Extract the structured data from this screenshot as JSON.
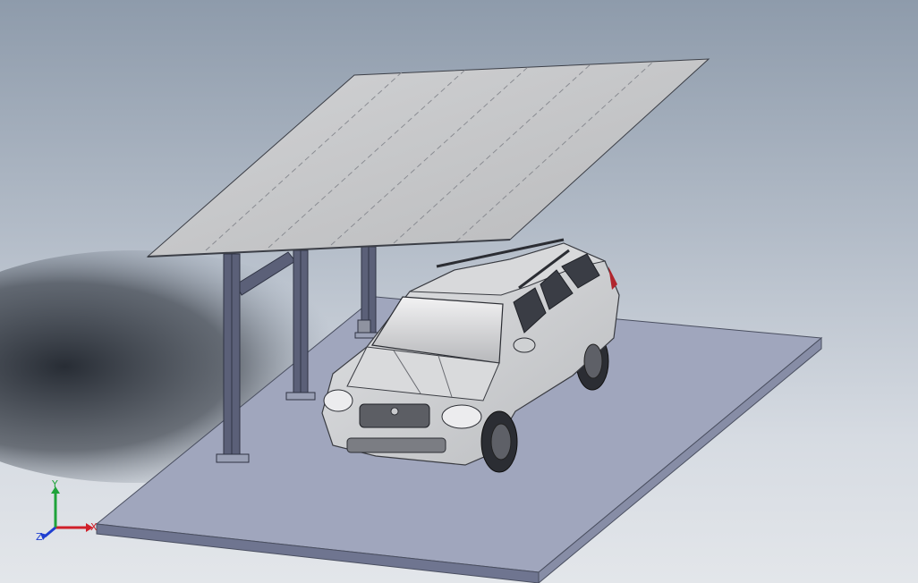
{
  "viewport": {
    "background_top": "#8e9bab",
    "background_bottom": "#e3e6ea"
  },
  "model": {
    "ground_plate_color": "#9ea4bb",
    "canopy_color": "#c3c4c6",
    "column_color": "#5b6078",
    "car_body_color": "#cfd1d3",
    "shadow_color": "#2a2f38"
  },
  "triad": {
    "x_label": "X",
    "y_label": "Y",
    "z_label": "Z",
    "x_color": "#d0202a",
    "y_color": "#1fa33a",
    "z_color": "#1f3fd1"
  }
}
